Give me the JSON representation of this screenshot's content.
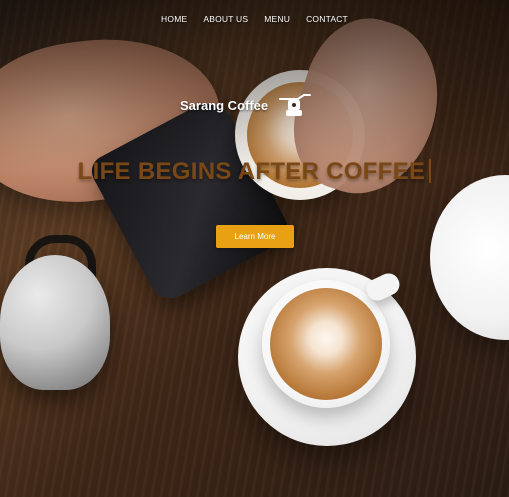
{
  "nav": {
    "items": [
      {
        "label": "HOME"
      },
      {
        "label": "ABOUT US"
      },
      {
        "label": "MENU"
      },
      {
        "label": "CONTACT"
      }
    ]
  },
  "brand": {
    "name": "Sarang Coffee",
    "logo_icon": "coffee-grinder-icon"
  },
  "hero": {
    "headline": "LIFE BEGINS AFTER COFFEE",
    "cta_label": "Learn More"
  },
  "colors": {
    "accent": "#e7a113",
    "headline": "#7a4716",
    "nav_text": "#ffffff"
  }
}
